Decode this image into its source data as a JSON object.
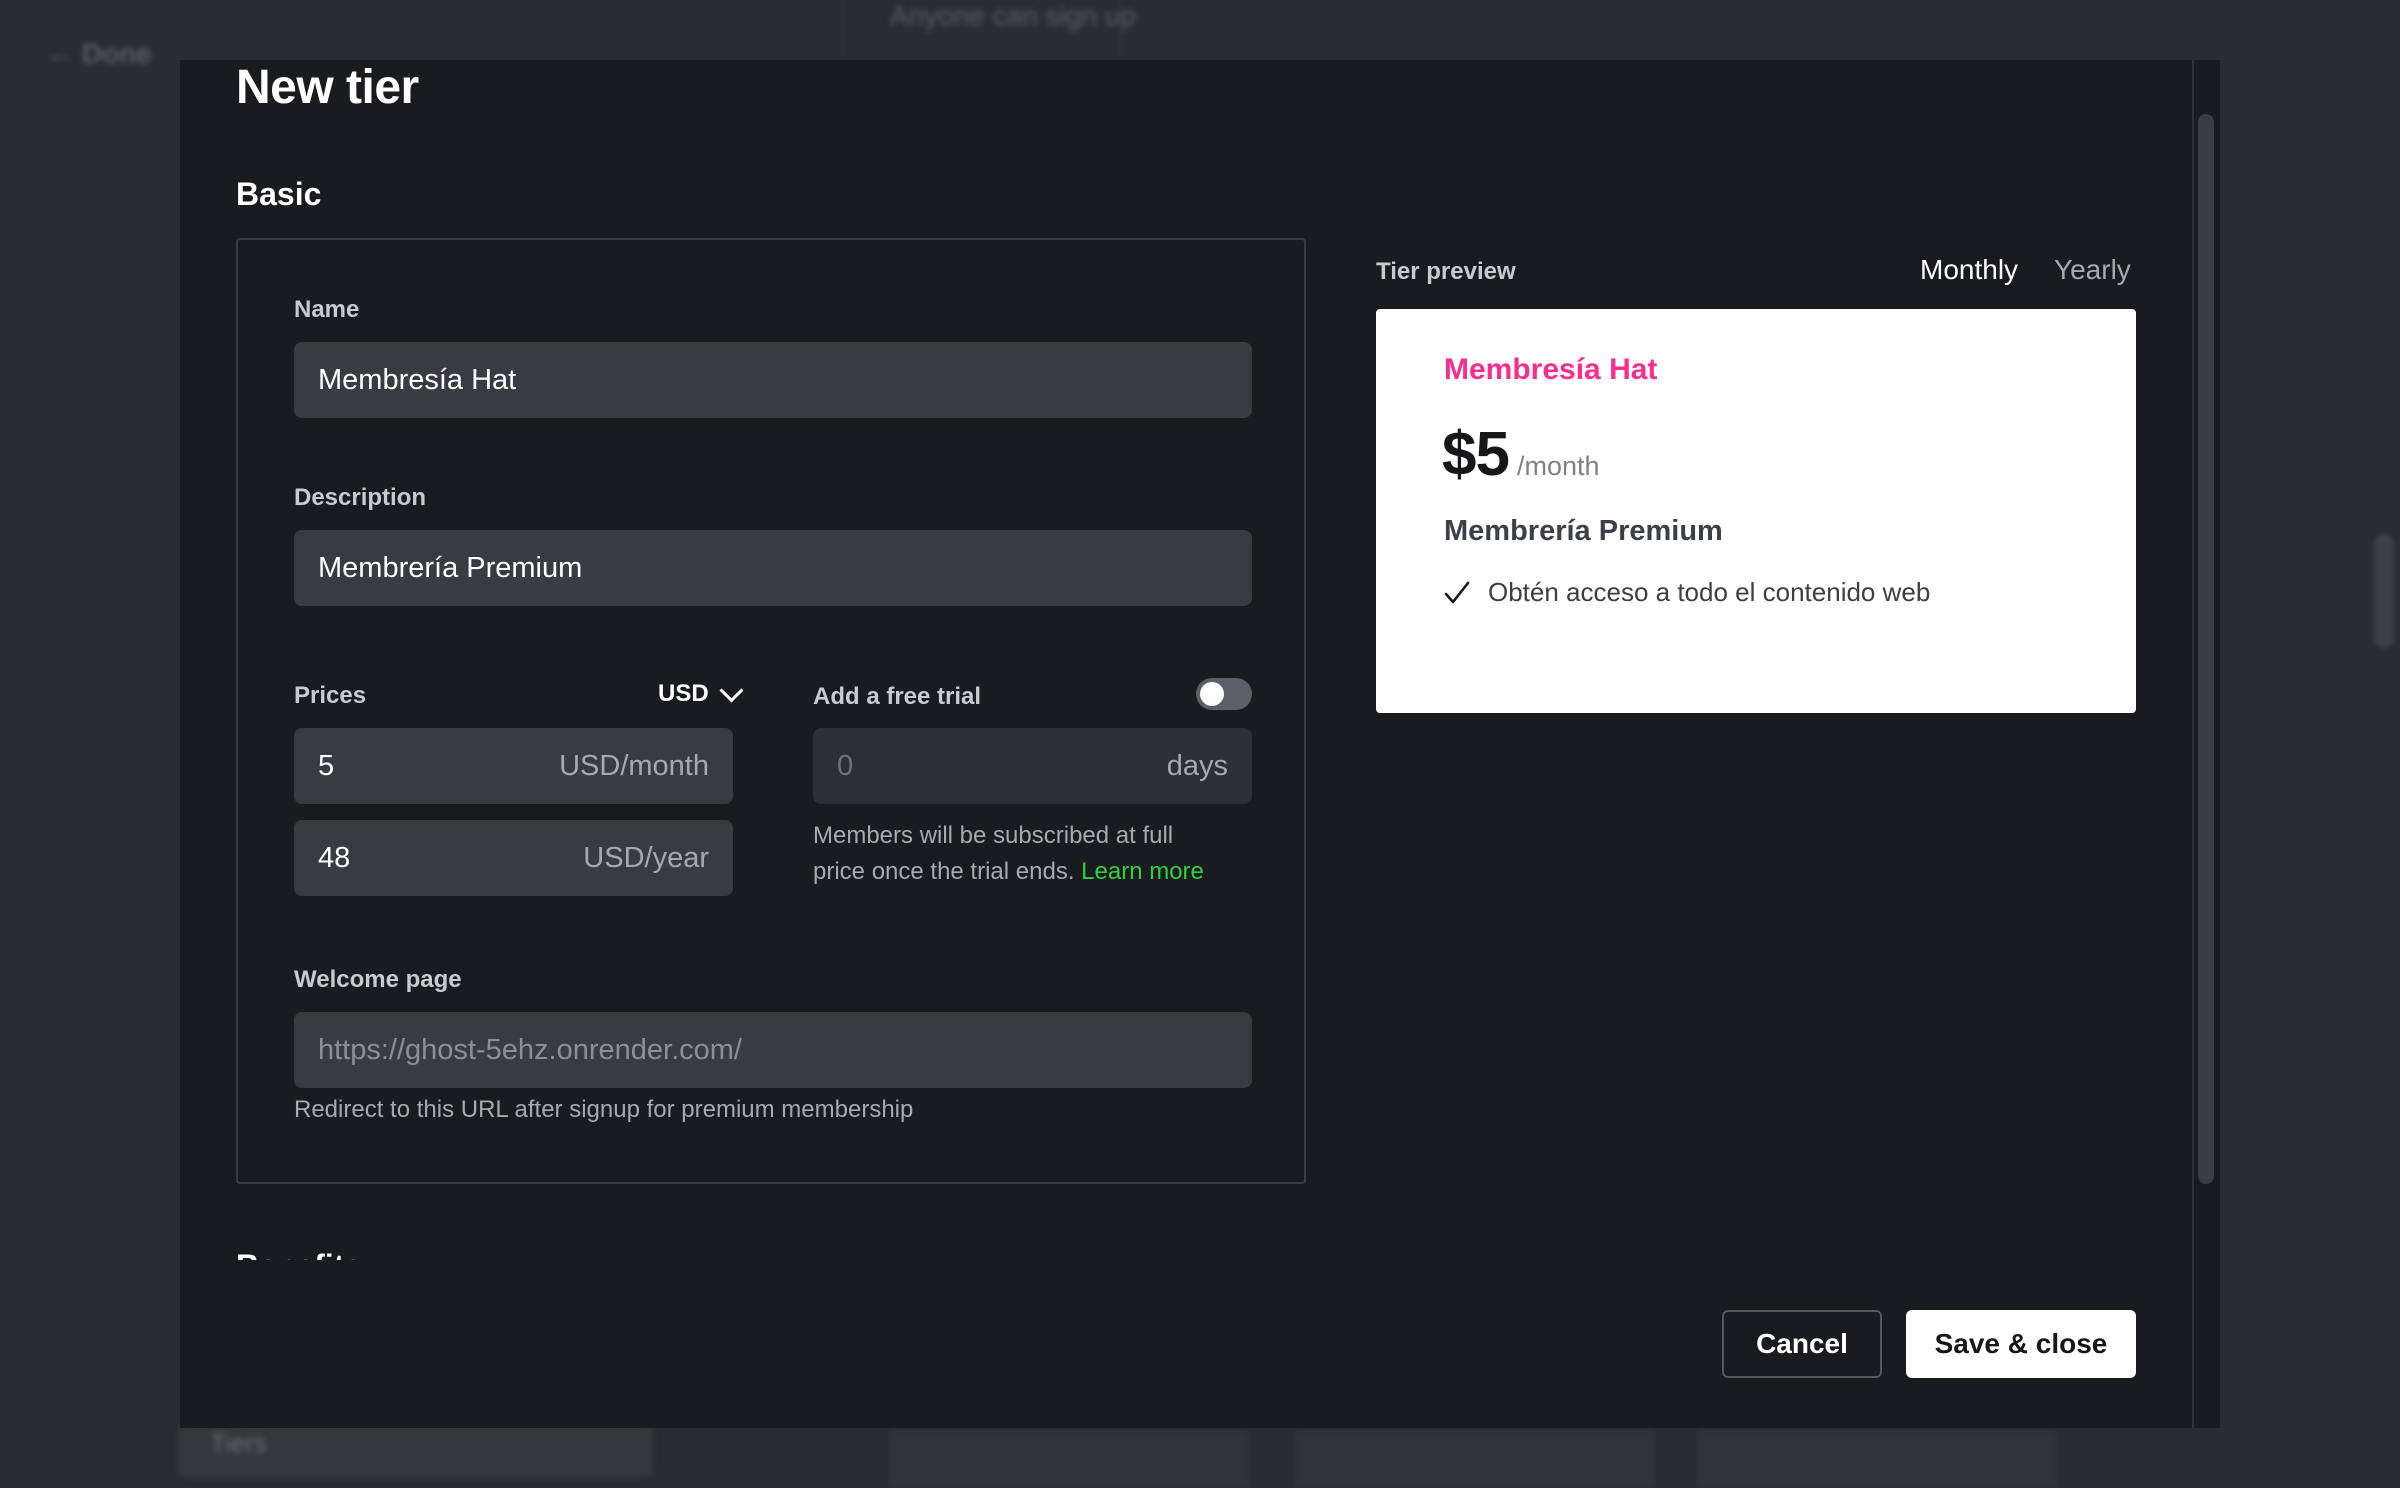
{
  "background": {
    "top_text": "Anyone can sign up",
    "back_label": "Done",
    "tiers_label": "Tiers"
  },
  "modal": {
    "title": "New tier",
    "section_basic": "Basic",
    "section_next": "Benefits",
    "name": {
      "label": "Name",
      "value": "Membresía Hat"
    },
    "description": {
      "label": "Description",
      "value": "Membrería Premium"
    },
    "prices": {
      "label": "Prices",
      "currency": "USD",
      "monthly": {
        "value": "5",
        "suffix": "USD/month"
      },
      "yearly": {
        "value": "48",
        "suffix": "USD/year"
      }
    },
    "trial": {
      "label": "Add a free trial",
      "enabled": false,
      "placeholder": "0",
      "suffix": "days",
      "hint": "Members will be subscribed at full price once the trial ends.",
      "hint_line1": "Members will be subscribed at full",
      "hint_line2": "price once the trial ends.",
      "link": "Learn more"
    },
    "welcome": {
      "label": "Welcome page",
      "placeholder": "https://ghost-5ehz.onrender.com/",
      "hint": "Redirect to this URL after signup for premium membership"
    },
    "preview": {
      "label": "Tier preview",
      "monthly": "Monthly",
      "yearly": "Yearly",
      "selected_period": "Monthly",
      "card": {
        "name": "Membresía Hat",
        "amount": "$5",
        "period": "/month",
        "description": "Membrería Premium",
        "benefits": [
          "Obtén acceso a todo el contenido web"
        ]
      }
    },
    "buttons": {
      "cancel": "Cancel",
      "save": "Save & close"
    }
  },
  "colors": {
    "accent_pink": "#fb2d8d",
    "link_green": "#30cf43",
    "modal_bg": "#191b1e",
    "field_bg": "#383c42"
  },
  "icons": [
    "chevron-down-icon",
    "check-icon",
    "toggle-switch"
  ]
}
